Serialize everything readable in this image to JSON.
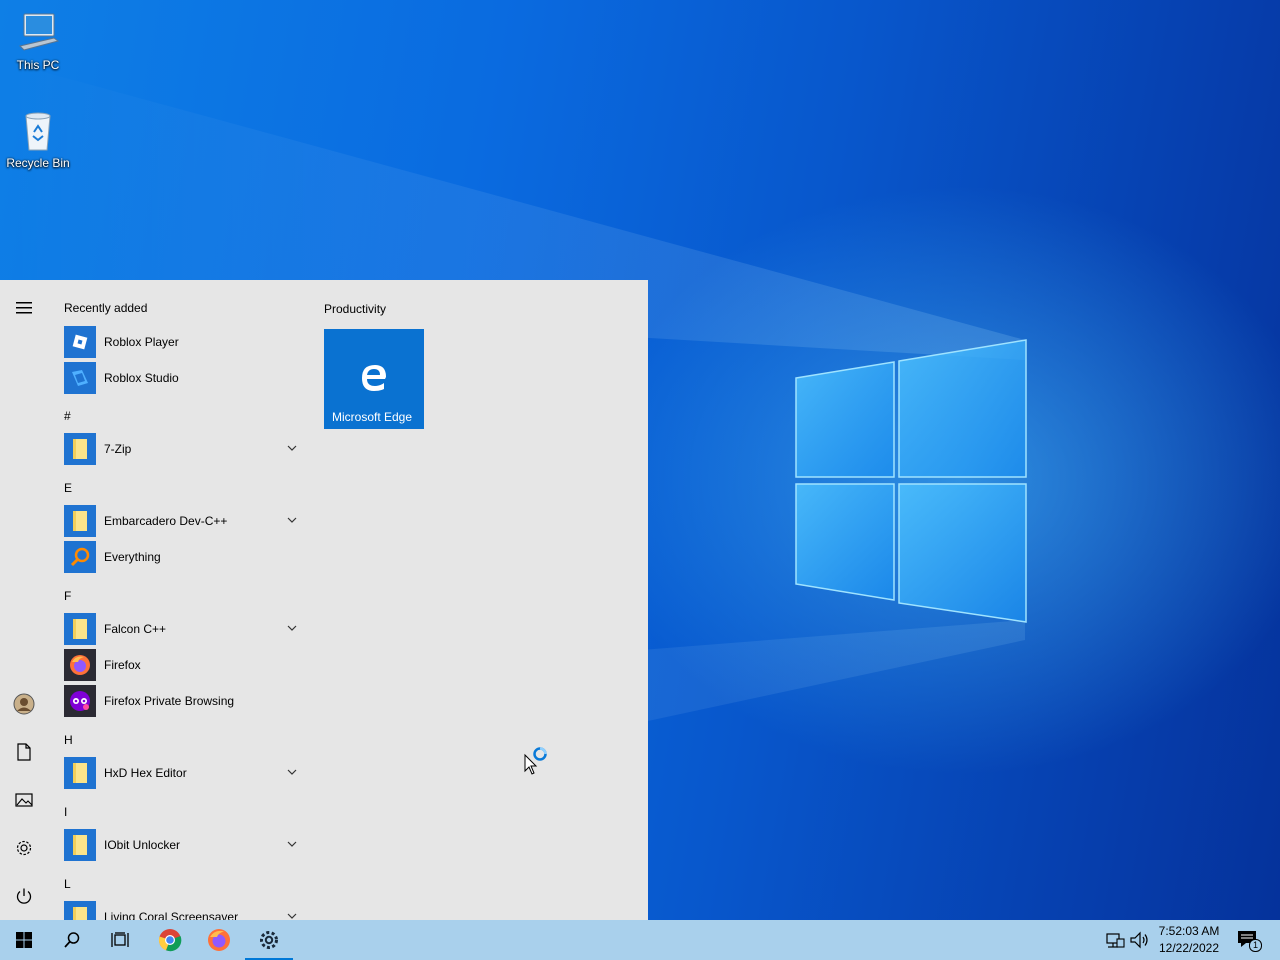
{
  "desktop": {
    "icons": [
      {
        "label": "This PC",
        "icon": "this-pc-icon"
      },
      {
        "label": "Recycle Bin",
        "icon": "recycle-bin-icon"
      }
    ]
  },
  "start_menu": {
    "recently_added_title": "Recently added",
    "recent": [
      {
        "label": "Roblox Player",
        "icon": "roblox-player-icon"
      },
      {
        "label": "Roblox Studio",
        "icon": "roblox-studio-icon"
      }
    ],
    "groups": [
      {
        "letter": "#",
        "apps": [
          {
            "label": "7-Zip",
            "icon": "folder-icon",
            "expandable": true
          }
        ]
      },
      {
        "letter": "E",
        "apps": [
          {
            "label": "Embarcadero Dev-C++",
            "icon": "folder-icon",
            "expandable": true
          },
          {
            "label": "Everything",
            "icon": "everything-search-icon",
            "expandable": false
          }
        ]
      },
      {
        "letter": "F",
        "apps": [
          {
            "label": "Falcon C++",
            "icon": "folder-icon",
            "expandable": true
          },
          {
            "label": "Firefox",
            "icon": "firefox-icon",
            "expandable": false
          },
          {
            "label": "Firefox Private Browsing",
            "icon": "firefox-private-icon",
            "expandable": false
          }
        ]
      },
      {
        "letter": "H",
        "apps": [
          {
            "label": "HxD Hex Editor",
            "icon": "folder-icon",
            "expandable": true
          }
        ]
      },
      {
        "letter": "I",
        "apps": [
          {
            "label": "IObit Unlocker",
            "icon": "folder-icon",
            "expandable": true
          }
        ]
      },
      {
        "letter": "L",
        "apps": [
          {
            "label": "Living Coral Screensaver",
            "icon": "folder-icon",
            "expandable": true
          }
        ]
      }
    ],
    "rail": [
      "hamburger-menu-icon",
      "user-avatar",
      "documents-icon",
      "pictures-icon",
      "settings-gear-icon",
      "power-icon"
    ],
    "tiles_group_title": "Productivity",
    "tiles": [
      {
        "label": "Microsoft Edge",
        "icon": "edge-icon",
        "color": "#0a72d1"
      }
    ]
  },
  "taskbar": {
    "buttons": [
      "windows-start-icon",
      "search-icon",
      "task-view-icon",
      "chrome-icon",
      "firefox-icon",
      "settings-gear-icon"
    ],
    "active": "settings-gear-icon",
    "tray": [
      "network-icon",
      "volume-icon"
    ],
    "time": "7:52:03 AM",
    "date": "12/22/2022",
    "notifications_count": "1"
  },
  "colors": {
    "accent": "#0078d7",
    "start_bg": "#e6e6e6",
    "taskbar_bg": "#a9d0ec",
    "tile_bg": "#0a72d1"
  }
}
